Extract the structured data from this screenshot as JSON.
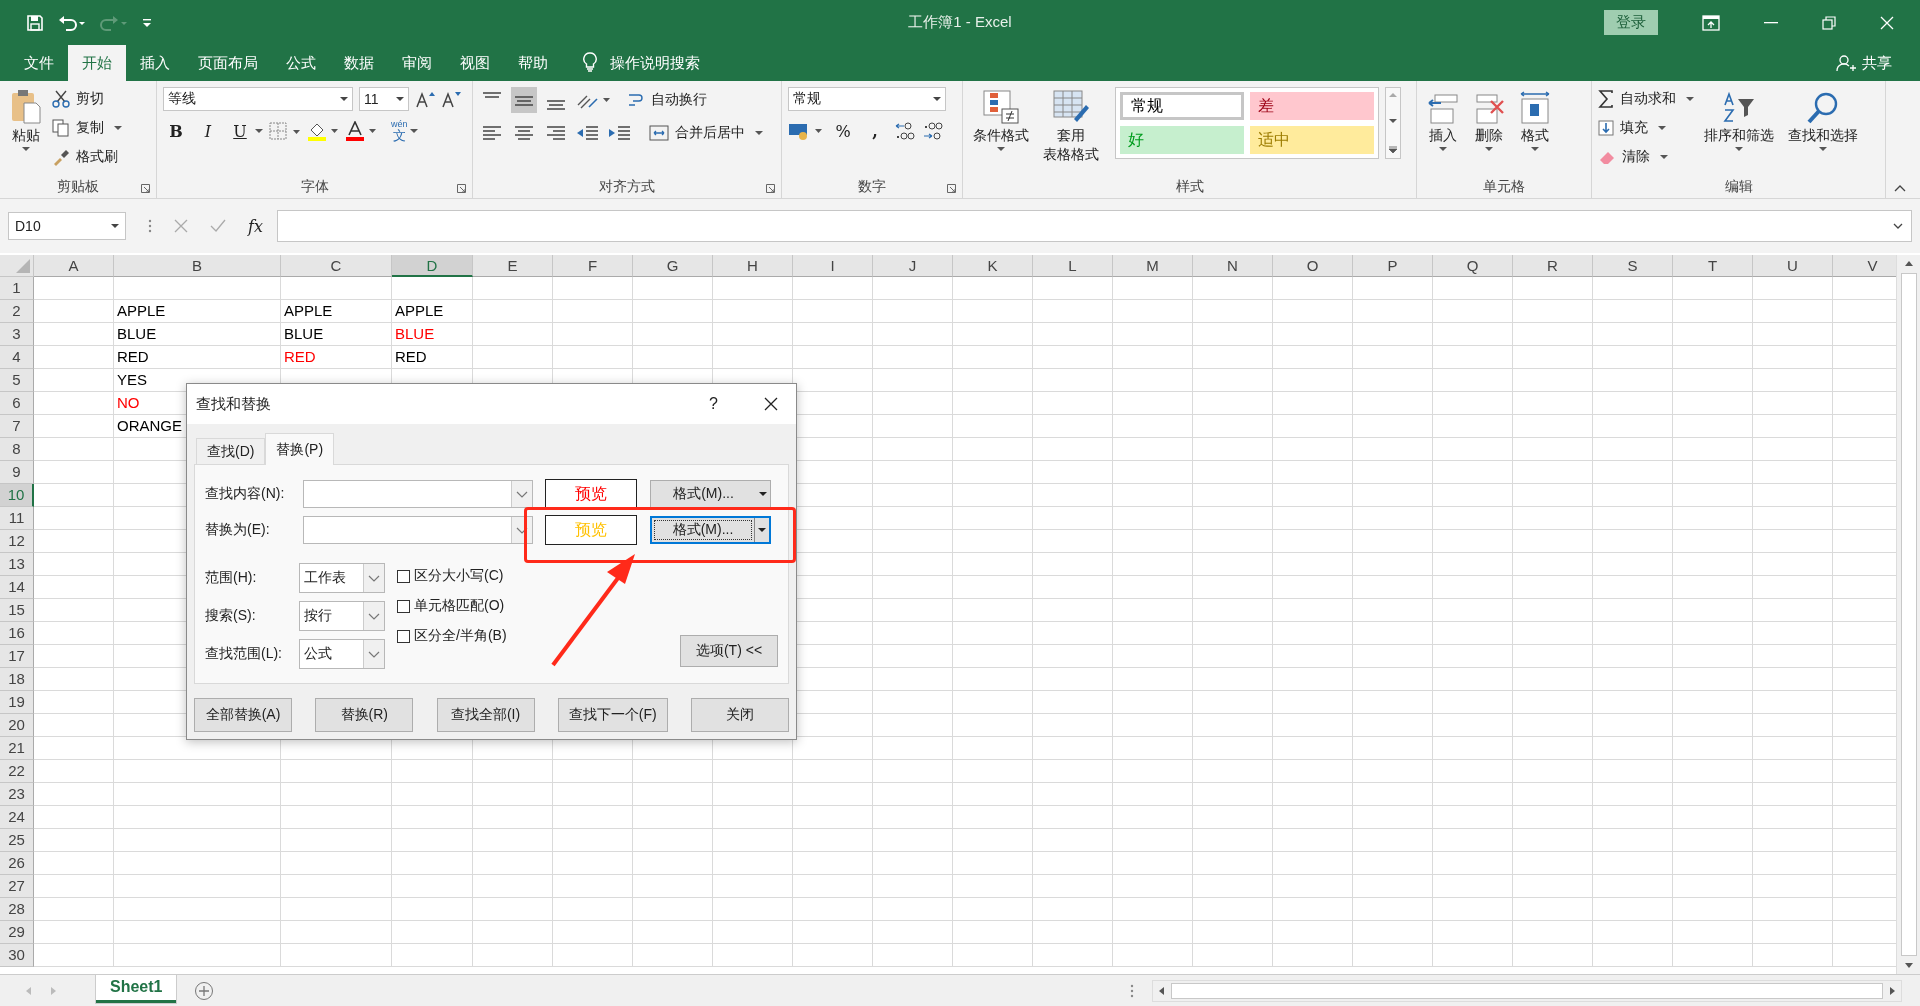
{
  "window": {
    "title": "工作簿1  -  Excel",
    "login": "登录"
  },
  "menu": {
    "tabs": [
      {
        "label": "文件",
        "selected": false
      },
      {
        "label": "开始",
        "selected": true
      },
      {
        "label": "插入",
        "selected": false
      },
      {
        "label": "页面布局",
        "selected": false
      },
      {
        "label": "公式",
        "selected": false
      },
      {
        "label": "数据",
        "selected": false
      },
      {
        "label": "审阅",
        "selected": false
      },
      {
        "label": "视图",
        "selected": false
      },
      {
        "label": "帮助",
        "selected": false
      }
    ],
    "tell_me": "操作说明搜索",
    "share": "共享"
  },
  "ribbon": {
    "clipboard": {
      "label": "剪贴板",
      "paste": "粘贴",
      "cut": "剪切",
      "copy": "复制",
      "format_painter": "格式刷"
    },
    "font": {
      "label": "字体",
      "name": "等线",
      "size": "11",
      "bold": "B",
      "italic": "I",
      "underline": "U",
      "pinyin": "wén",
      "phonetic": "文"
    },
    "alignment": {
      "label": "对齐方式",
      "wrap": "自动换行",
      "merge": "合并后居中"
    },
    "number": {
      "label": "数字",
      "format": "常规",
      "percent": "%",
      "comma": ","
    },
    "styles": {
      "label": "样式",
      "conditional": "条件格式",
      "table_format": [
        "套用",
        "表格格式"
      ],
      "cells": [
        {
          "text": "常规",
          "color": "#ffffff",
          "selected": true
        },
        {
          "text": "差",
          "color": "#ffc7ce",
          "selected": false
        },
        {
          "text": "好",
          "color": "#c6efce",
          "selected": false
        },
        {
          "text": "适中",
          "color": "#ffeb9c",
          "selected": false
        }
      ]
    },
    "cells": {
      "label": "单元格",
      "insert": "插入",
      "delete": "删除",
      "format": "格式"
    },
    "editing": {
      "label": "编辑",
      "autosum": "自动求和",
      "fill": "填充",
      "clear": "清除",
      "sort_filter": "排序和筛选",
      "find_select": "查找和选择"
    }
  },
  "formula_bar": {
    "name_box": "D10",
    "fx": "fx"
  },
  "sheet": {
    "columns": [
      {
        "label": "A",
        "selected": false
      },
      {
        "label": "B",
        "selected": false
      },
      {
        "label": "C",
        "selected": false
      },
      {
        "label": "D",
        "selected": true
      },
      {
        "label": "E",
        "selected": false
      },
      {
        "label": "F",
        "selected": false
      },
      {
        "label": "G",
        "selected": false
      },
      {
        "label": "H",
        "selected": false
      },
      {
        "label": "I",
        "selected": false
      },
      {
        "label": "J",
        "selected": false
      },
      {
        "label": "K",
        "selected": false
      },
      {
        "label": "L",
        "selected": false
      },
      {
        "label": "M",
        "selected": false
      },
      {
        "label": "N",
        "selected": false
      },
      {
        "label": "O",
        "selected": false
      },
      {
        "label": "P",
        "selected": false
      },
      {
        "label": "Q",
        "selected": false
      },
      {
        "label": "R",
        "selected": false
      },
      {
        "label": "S",
        "selected": false
      },
      {
        "label": "T",
        "selected": false
      },
      {
        "label": "U",
        "selected": false
      },
      {
        "label": "V",
        "selected": false
      }
    ],
    "rows": [
      {
        "label": "1",
        "selected": false
      },
      {
        "label": "2",
        "selected": false,
        "cells": [
          null,
          {
            "text": "APPLE",
            "color": "#000000"
          },
          {
            "text": "APPLE",
            "color": "#000000"
          },
          {
            "text": "APPLE",
            "color": "#000000"
          }
        ]
      },
      {
        "label": "3",
        "selected": false,
        "cells": [
          null,
          {
            "text": "BLUE",
            "color": "#000000"
          },
          {
            "text": "BLUE",
            "color": "#000000"
          },
          {
            "text": "BLUE",
            "color": "#ff0000"
          }
        ]
      },
      {
        "label": "4",
        "selected": false,
        "cells": [
          null,
          {
            "text": "RED",
            "color": "#000000"
          },
          {
            "text": "RED",
            "color": "#ff0000"
          },
          {
            "text": "RED",
            "color": "#000000"
          }
        ]
      },
      {
        "label": "5",
        "selected": false,
        "cells": [
          null,
          {
            "text": "YES",
            "color": "#000000"
          }
        ]
      },
      {
        "label": "6",
        "selected": false,
        "cells": [
          null,
          {
            "text": "NO",
            "color": "#ff0000"
          }
        ]
      },
      {
        "label": "7",
        "selected": false,
        "cells": [
          null,
          {
            "text": "ORANGE",
            "color": "#000000"
          }
        ]
      },
      {
        "label": "8",
        "selected": false
      },
      {
        "label": "9",
        "selected": false
      },
      {
        "label": "10",
        "selected": true
      },
      {
        "label": "11",
        "selected": false
      },
      {
        "label": "12",
        "selected": false
      },
      {
        "label": "13",
        "selected": false
      },
      {
        "label": "14",
        "selected": false
      },
      {
        "label": "15",
        "selected": false
      },
      {
        "label": "16",
        "selected": false
      },
      {
        "label": "17",
        "selected": false
      },
      {
        "label": "18",
        "selected": false
      },
      {
        "label": "19",
        "selected": false
      },
      {
        "label": "20",
        "selected": false
      },
      {
        "label": "21",
        "selected": false
      },
      {
        "label": "22",
        "selected": false
      },
      {
        "label": "23",
        "selected": false
      },
      {
        "label": "24",
        "selected": false
      },
      {
        "label": "25",
        "selected": false
      },
      {
        "label": "26",
        "selected": false
      },
      {
        "label": "27",
        "selected": false
      },
      {
        "label": "28",
        "selected": false
      },
      {
        "label": "29",
        "selected": false
      },
      {
        "label": "30",
        "selected": false
      }
    ],
    "tabs": [
      {
        "label": "Sheet1",
        "selected": true
      }
    ]
  },
  "dialog": {
    "title": "查找和替换",
    "help": "?",
    "tabs": [
      {
        "label": "查找(D)",
        "selected": false
      },
      {
        "label": "替换(P)",
        "selected": true
      }
    ],
    "find": {
      "label": "查找内容(N):",
      "preview": "预览",
      "color": "#ff0000",
      "format": "格式(M)...",
      "focused": false
    },
    "replace": {
      "label": "替换为(E):",
      "preview": "预览",
      "color": "#ffc000",
      "format": "格式(M)...",
      "focused": true
    },
    "options": [
      {
        "label": "范围(H):",
        "value": "工作表"
      },
      {
        "label": "搜索(S):",
        "value": "按行"
      },
      {
        "label": "查找范围(L):",
        "value": "公式"
      }
    ],
    "checkboxes": [
      {
        "label": "区分大小写(C)",
        "checked": false
      },
      {
        "label": "单元格匹配(O)",
        "checked": false
      },
      {
        "label": "区分全/半角(B)",
        "checked": false
      }
    ],
    "options_button": "选项(T) <<",
    "buttons": [
      "全部替换(A)",
      "替换(R)",
      "查找全部(I)",
      "查找下一个(F)",
      "关闭"
    ]
  }
}
